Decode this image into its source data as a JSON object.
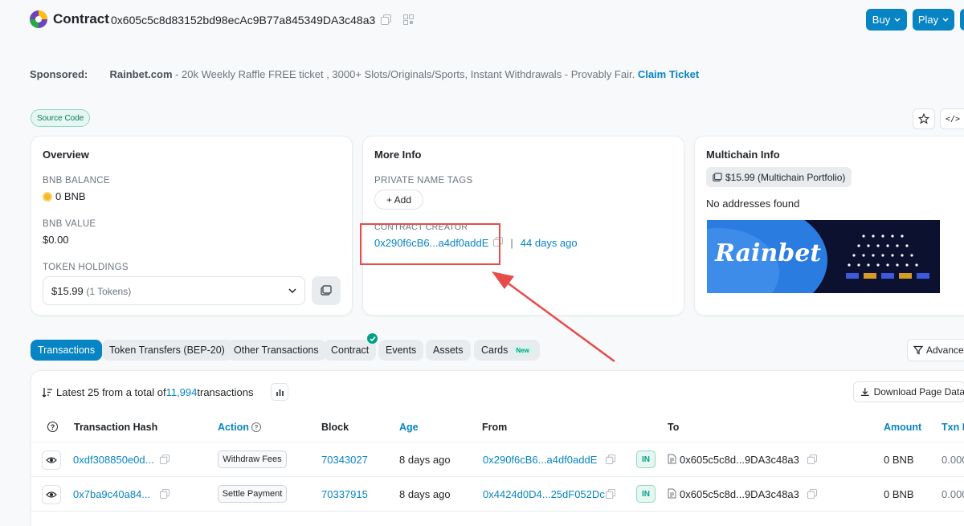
{
  "header": {
    "title": "Contract",
    "address": "0x605c5c8d83152bd98ecAc9B77a845349DA3c48a3",
    "buy_label": "Buy",
    "play_label": "Play"
  },
  "sponsored": {
    "label": "Sponsored:",
    "brand": "Rainbet.com",
    "text": " - 20k Weekly Raffle FREE ticket , 3000+ Slots/Originals/Sports, Instant Withdrawals - Provably Fair. ",
    "cta": "Claim Ticket"
  },
  "source_badge": "Source Code",
  "overview": {
    "title": "Overview",
    "balance_label": "BNB BALANCE",
    "balance_value": "0 BNB",
    "value_label": "BNB VALUE",
    "value": "$0.00",
    "holdings_label": "TOKEN HOLDINGS",
    "holdings_value": "$15.99",
    "holdings_count": "(1 Tokens)"
  },
  "more_info": {
    "title": "More Info",
    "tags_label": "PRIVATE NAME TAGS",
    "add_label": "+ Add",
    "creator_label": "CONTRACT CREATOR",
    "creator_address": "0x290f6cB6...a4df0addE",
    "creator_sep": "|",
    "creator_age": "44 days ago"
  },
  "multichain": {
    "title": "Multichain Info",
    "portfolio": "$15.99 (Multichain Portfolio)",
    "no_addresses": "No addresses found",
    "banner_brand": "Rainbet"
  },
  "tabs": [
    {
      "label": "Transactions"
    },
    {
      "label": "Token Transfers (BEP-20)"
    },
    {
      "label": "Other Transactions"
    },
    {
      "label": "Contract"
    },
    {
      "label": "Events"
    },
    {
      "label": "Assets"
    },
    {
      "label": "Cards"
    }
  ],
  "cards_badge": "New",
  "advanced_label": "Advance",
  "summary": {
    "prefix": "Latest 25 from a total of ",
    "count": "11,994",
    "suffix": " transactions",
    "download_label": "Download Page Data"
  },
  "table": {
    "headers": {
      "hash": "Transaction Hash",
      "action": "Action",
      "block": "Block",
      "age": "Age",
      "from": "From",
      "to": "To",
      "amount": "Amount",
      "fee": "Txn F"
    },
    "rows": [
      {
        "hash": "0xdf308850e0d...",
        "method": "Withdraw Fees",
        "block": "70343027",
        "age": "8 days ago",
        "from": "0x290f6cB6...a4df0addE",
        "direction": "IN",
        "to": "0x605c5c8d...9DA3c48a3",
        "amount": "0 BNB",
        "fee": "0.000"
      },
      {
        "hash": "0x7ba9c40a84...",
        "method": "Settle Payment",
        "block": "70337915",
        "age": "8 days ago",
        "from": "0x4424d0D4...25dF052Dc",
        "direction": "IN",
        "to": "0x605c5c8d...9DA3c48a3",
        "amount": "0 BNB",
        "fee": "0.000"
      }
    ]
  },
  "colors": {
    "primary": "#0784c3",
    "annotation": "#e74c4c",
    "in_badge": "#00a186"
  }
}
